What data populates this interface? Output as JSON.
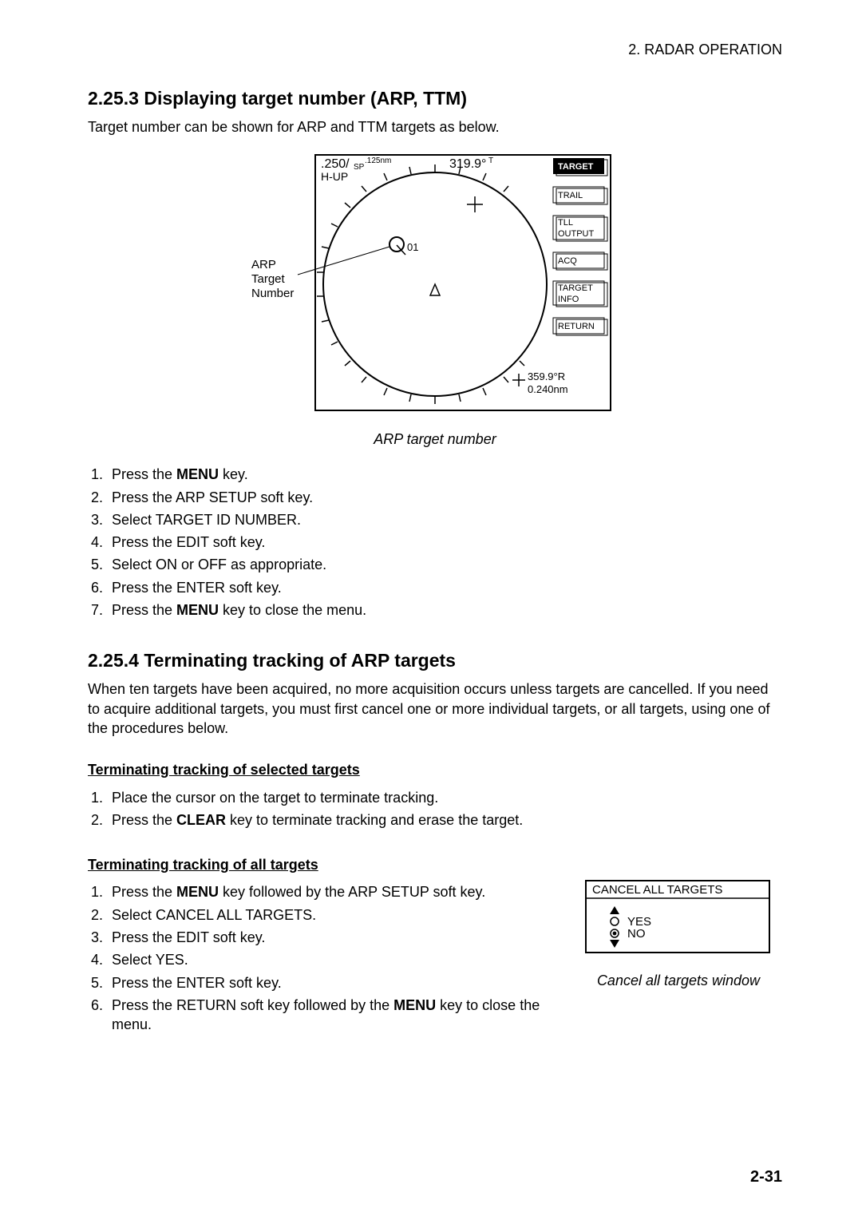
{
  "header": {
    "chapter": "2. RADAR OPERATION"
  },
  "s1": {
    "heading": "2.25.3  Displaying target number (ARP, TTM)",
    "intro": "Target number can be shown for ARP and TTM targets as below.",
    "caption": "ARP target number",
    "radar": {
      "range_main": ".250/",
      "range_sp": "SP",
      "range_sub": ".125nm",
      "hup": "H-UP",
      "bearing": "319.9°",
      "bearing_suf": "T",
      "target_num": "01",
      "label1": "ARP",
      "label2": "Target",
      "label3": "Number",
      "softkeys": {
        "k1": "TARGET",
        "k2": "TRAIL",
        "k3a": "TLL",
        "k3b": "OUTPUT",
        "k4": "ACQ",
        "k5a": "TARGET",
        "k5b": "INFO",
        "k6": "RETURN"
      },
      "cursor_brg": "359.9°R",
      "cursor_rng": "0.240nm"
    },
    "steps": {
      "s1a": "Press the ",
      "s1b": "MENU",
      "s1c": " key.",
      "s2": "Press the ARP SETUP soft key.",
      "s3": "Select TARGET ID NUMBER.",
      "s4": "Press the EDIT soft key.",
      "s5": "Select ON or OFF as appropriate.",
      "s6": "Press the ENTER soft key.",
      "s7a": "Press the ",
      "s7b": "MENU",
      "s7c": " key to close the menu."
    }
  },
  "s2": {
    "heading": "2.25.4  Terminating tracking of ARP targets",
    "intro": "When ten targets have been acquired, no more acquisition occurs unless targets are cancelled. If you need to acquire additional targets, you must first cancel one or more individual targets, or all targets, using one of the procedures below.",
    "sub1": "Terminating tracking of selected targets",
    "sub1_steps": {
      "s1": "Place the cursor on the target to terminate tracking.",
      "s2a": "Press the ",
      "s2b": "CLEAR",
      "s2c": " key to terminate tracking and erase the target."
    },
    "sub2": "Terminating tracking of all targets",
    "sub2_steps": {
      "s1a": "Press the ",
      "s1b": "MENU",
      "s1c": " key followed by the ARP SETUP soft key.",
      "s2": "Select CANCEL ALL TARGETS.",
      "s3": "Press the EDIT soft key.",
      "s4": "Select YES.",
      "s5": "Press the ENTER soft key.",
      "s6a": "Press the RETURN soft key followed by the ",
      "s6b": "MENU",
      "s6c": " key to close the menu."
    },
    "cancelbox": {
      "title": "CANCEL ALL TARGETS",
      "yes": "YES",
      "no": "NO"
    },
    "cancel_caption": "Cancel all targets window"
  },
  "pagenum": "2-31"
}
